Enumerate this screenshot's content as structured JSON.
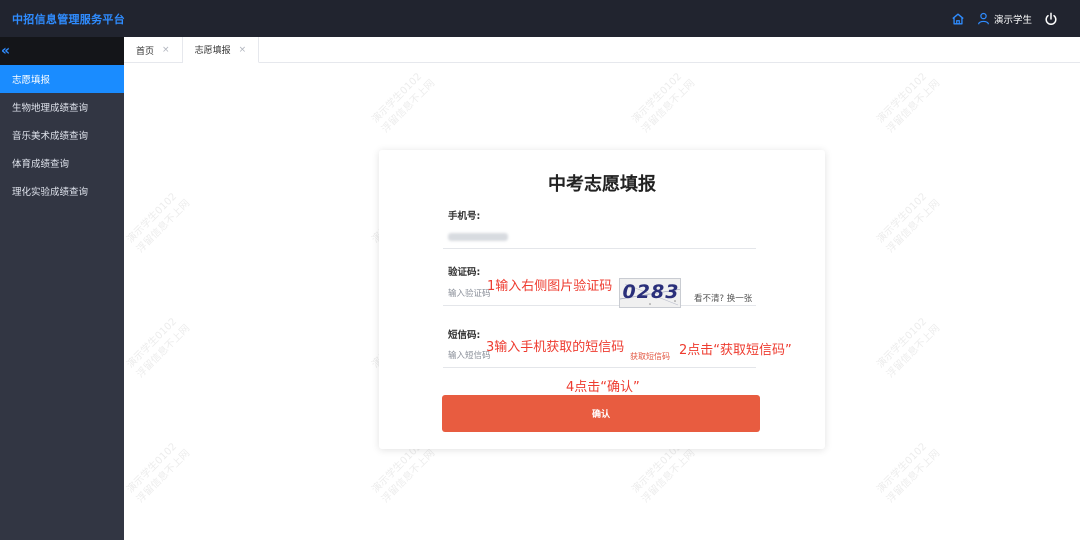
{
  "header": {
    "brand": "中招信息管理服务平台",
    "home_icon": "home-icon",
    "user_icon": "user-icon",
    "username": "演示学生",
    "power_icon": "power-icon"
  },
  "sidebar": {
    "collapse_glyph": "«",
    "items": [
      {
        "label": "志愿填报"
      },
      {
        "label": "生物地理成绩查询"
      },
      {
        "label": "音乐美术成绩查询"
      },
      {
        "label": "体育成绩查询"
      },
      {
        "label": "理化实验成绩查询"
      }
    ]
  },
  "tabs": [
    {
      "label": "首页",
      "close": "×"
    },
    {
      "label": "志愿填报",
      "close": "×"
    }
  ],
  "watermark": {
    "line1": "演示学生0102",
    "line2": "浮留信息不上网"
  },
  "form": {
    "title": "中考志愿填报",
    "phone_label": "手机号:",
    "captcha_label": "验证码:",
    "captcha_placeholder": "输入验证码",
    "captcha_image_text": "0283",
    "refresh_text": "看不清? 换一张",
    "sms_label": "短信码:",
    "sms_placeholder": "输入短信码",
    "sms_button": "获取短信码",
    "confirm_button": "确认"
  },
  "annotations": {
    "step1": "1输入右侧图片验证码",
    "step2": "2点击“获取短信码”",
    "step3": "3输入手机获取的短信码",
    "step4": "4点击“确认”"
  },
  "colors": {
    "header_bg": "#21242f",
    "brand": "#2f8cff",
    "sidebar_bg": "#323643",
    "active_nav": "#1a8cff",
    "confirm": "#e85c40",
    "annotation": "#ee3b2f"
  }
}
